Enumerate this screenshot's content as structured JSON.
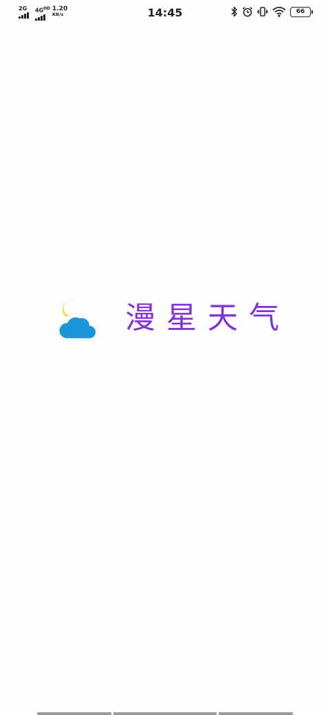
{
  "status_bar": {
    "sim1_label": "2G",
    "sim2_label": "4G",
    "sim2_sup": "HD",
    "net_speed": "1.20",
    "net_unit": "KB/s",
    "time": "14:45",
    "battery": "66",
    "icons": [
      "bluetooth-icon",
      "alarm-icon",
      "vibrate-icon",
      "wifi-icon",
      "battery-icon"
    ]
  },
  "splash": {
    "app_name": "漫星天气",
    "logo": "sun-cloud-logo",
    "colors": {
      "title": "#8033d6",
      "cloud": "#1a96dc",
      "sun": "#f5de3a"
    }
  }
}
